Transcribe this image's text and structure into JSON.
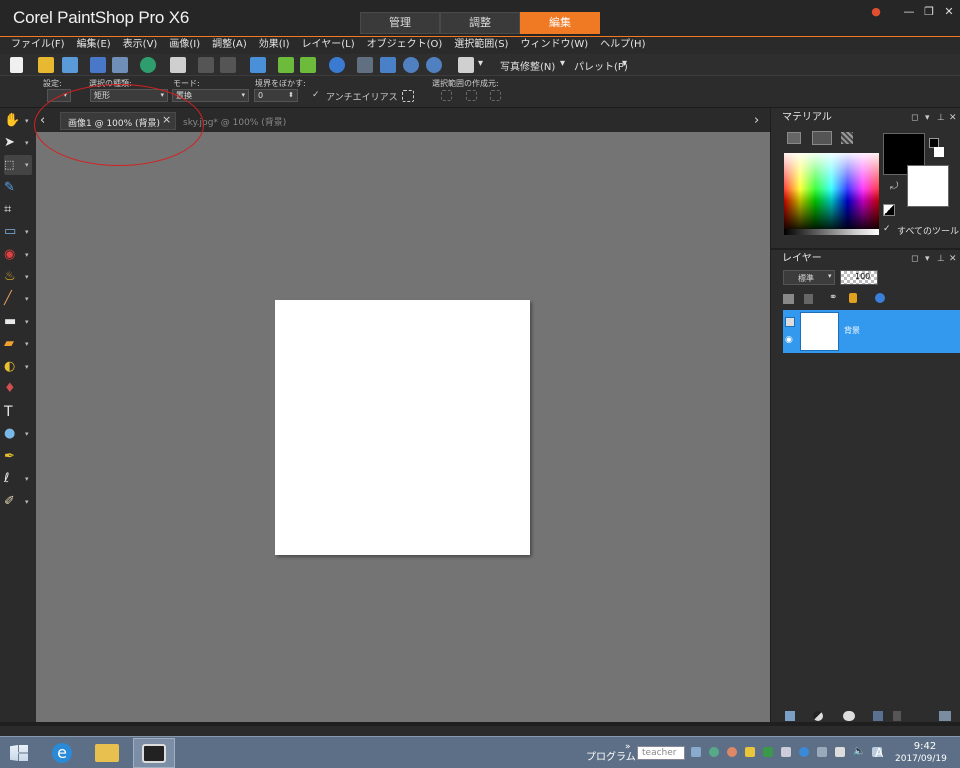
{
  "titlebar": {
    "app_title": "Corel PaintShop Pro X6",
    "workspace_tabs": [
      "管理",
      "調整",
      "編集"
    ],
    "active_tab": "編集",
    "user_icon": "user-icon",
    "minimize": "—",
    "restore": "❐",
    "close": "✕"
  },
  "menubar": {
    "items": [
      "ファイル(F)",
      "編集(E)",
      "表示(V)",
      "画像(I)",
      "調整(A)",
      "効果(I)",
      "レイヤー(L)",
      "オブジェクト(O)",
      "選択範囲(S)",
      "ウィンドウ(W)",
      "ヘルプ(H)"
    ]
  },
  "toolbar": {
    "photo_fix_label": "写真修整(N)",
    "palette_label": "パレット(P)"
  },
  "options": {
    "preset_label": "設定:",
    "selection_type_label": "選択の種類:",
    "selection_type_value": "矩形",
    "mode_label": "モード:",
    "mode_value": "置換",
    "feather_label": "境界をぼかす:",
    "feather_value": "0",
    "antialias_label": "アンチエイリアス",
    "create_from_label": "選択範囲の作成元:"
  },
  "tabs": {
    "prev": "‹",
    "next": "›",
    "active_doc": "画像1 @ 100% (背景)",
    "close": "×",
    "inactive_doc": "sky.jpg* @ 100% (背景)"
  },
  "materials": {
    "title": "マテリアル",
    "all_tools_label": "すべてのツール",
    "foreground_color": "#000000",
    "background_color": "#ffffff"
  },
  "layers": {
    "title": "レイヤー",
    "blend_mode": "標準",
    "opacity": "100",
    "layer_name": "背景"
  },
  "taskbar": {
    "programs_label": "プログラム",
    "search_value": "teacher",
    "ime_label": "A",
    "time": "9:42",
    "date": "2017/09/19"
  },
  "colors": {
    "accent": "#f07a24",
    "layer_selected": "#3399ee",
    "canvas_bg": "#747474",
    "annotation": "#d42020"
  }
}
